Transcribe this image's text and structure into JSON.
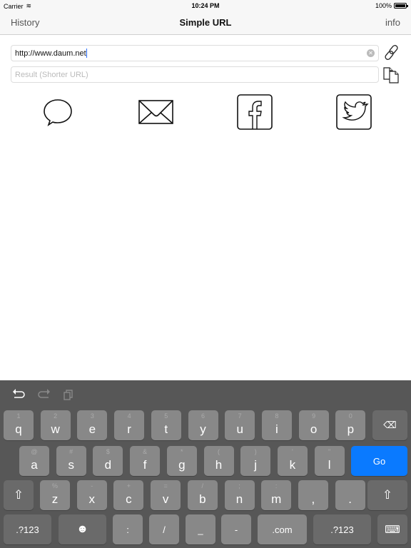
{
  "status": {
    "carrier": "Carrier",
    "time": "10:24 PM",
    "battery": "100%"
  },
  "nav": {
    "left": "History",
    "title": "Simple URL",
    "right": "info"
  },
  "url_field": {
    "value": "http://www.daum.net"
  },
  "result_field": {
    "placeholder": "Result (Shorter URL)"
  },
  "share": [
    "message",
    "mail",
    "facebook",
    "twitter"
  ],
  "keyboard": {
    "row1": [
      [
        "1",
        "q"
      ],
      [
        "2",
        "w"
      ],
      [
        "3",
        "e"
      ],
      [
        "4",
        "r"
      ],
      [
        "5",
        "t"
      ],
      [
        "6",
        "y"
      ],
      [
        "7",
        "u"
      ],
      [
        "8",
        "i"
      ],
      [
        "9",
        "o"
      ],
      [
        "0",
        "p"
      ]
    ],
    "row2": [
      [
        "@",
        "a"
      ],
      [
        "#",
        "s"
      ],
      [
        "$",
        "d"
      ],
      [
        "&",
        "f"
      ],
      [
        "*",
        "g"
      ],
      [
        "(",
        "h"
      ],
      [
        ")",
        "j"
      ],
      [
        "'",
        "k"
      ],
      [
        "\"",
        "l"
      ]
    ],
    "row3": [
      [
        "%",
        "z"
      ],
      [
        "-",
        "x"
      ],
      [
        "+",
        "c"
      ],
      [
        "=",
        "v"
      ],
      [
        "/",
        "b"
      ],
      [
        ";",
        "n"
      ],
      [
        ":",
        "m"
      ],
      [
        "",
        ","
      ],
      [
        "",
        "."
      ]
    ],
    "go": "Go",
    "row4": {
      "num_left": ".?123",
      "colon": ":",
      "slash": "/",
      "underscore": "_",
      "dash": "-",
      "dotcom": ".com",
      "num_right": ".?123"
    }
  }
}
